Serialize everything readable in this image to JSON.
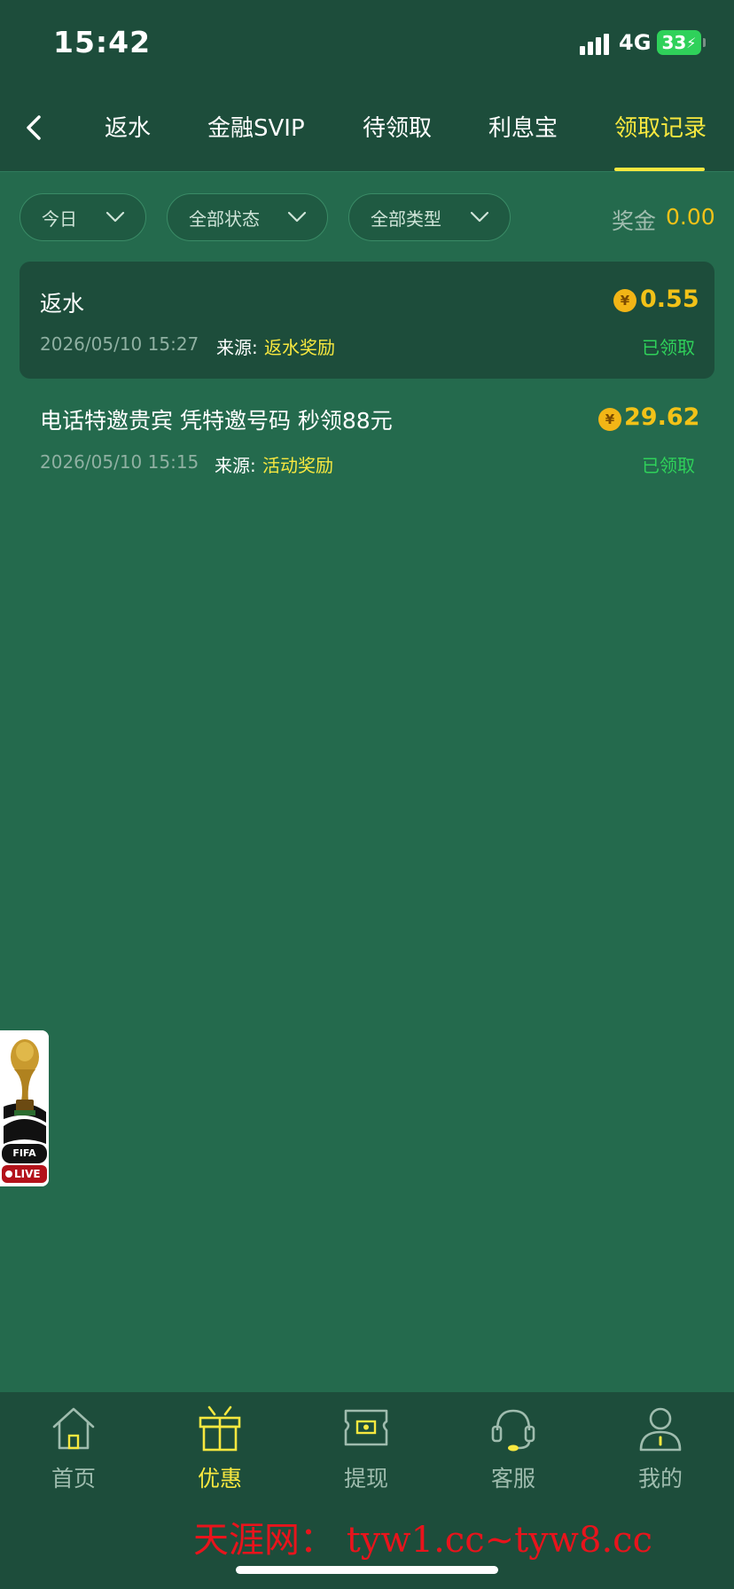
{
  "status_bar": {
    "time": "15:42",
    "network": "4G",
    "battery": "33"
  },
  "tabs": [
    {
      "label": "返水",
      "active": false
    },
    {
      "label": "金融SVIP",
      "active": false
    },
    {
      "label": "待领取",
      "active": false
    },
    {
      "label": "利息宝",
      "active": false
    },
    {
      "label": "领取记录",
      "active": true
    }
  ],
  "filters": {
    "date": "今日",
    "status": "全部状态",
    "type": "全部类型",
    "bonus_label": "奖金",
    "bonus_value": "0.00"
  },
  "records": [
    {
      "title": "返水",
      "amount": "0.55",
      "coin_symbol": "¥",
      "date": "2026/05/10 15:27",
      "source_label": "来源:",
      "source_value": "返水奖励",
      "status": "已领取"
    },
    {
      "title": "电话特邀贵宾 凭特邀号码 秒领88元",
      "amount": "29.62",
      "coin_symbol": "¥",
      "date": "2026/05/10 15:15",
      "source_label": "来源:",
      "source_value": "活动奖励",
      "status": "已领取"
    }
  ],
  "floating_widget": {
    "brand": "FIFA",
    "live": "LIVE"
  },
  "bottom_nav": [
    {
      "label": "首页",
      "icon": "home-icon",
      "active": false
    },
    {
      "label": "优惠",
      "icon": "gift-icon",
      "active": true
    },
    {
      "label": "提现",
      "icon": "withdraw-icon",
      "active": false
    },
    {
      "label": "客服",
      "icon": "headset-icon",
      "active": false
    },
    {
      "label": "我的",
      "icon": "user-icon",
      "active": false
    }
  ],
  "watermark": "天涯网： tyw1.cc~tyw8.cc",
  "colors": {
    "background": "#246a4d",
    "header": "#1d4d3b",
    "accent": "#f8e83f",
    "amount": "#f2c218",
    "status": "#2fd15a"
  }
}
